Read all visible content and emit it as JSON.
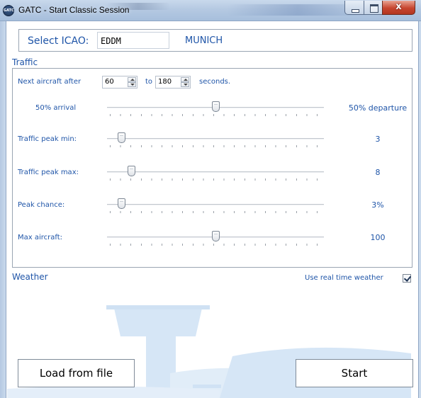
{
  "window": {
    "title": "GATC - Start Classic Session",
    "icon_name": "gatc-logo-icon",
    "icon_text": "GATC",
    "controls": [
      "minimize-icon",
      "maximize-icon",
      "close-icon"
    ],
    "close_glyph": "x"
  },
  "icao": {
    "label": "Select ICAO:",
    "value": "EDDM",
    "city": "MUNICH"
  },
  "traffic": {
    "section_label": "Traffic",
    "next_aircraft": {
      "prefix": "Next aircraft after",
      "min_value": "60",
      "joiner": "to",
      "max_value": "180",
      "suffix": "seconds."
    },
    "sliders": [
      {
        "label": "50% arrival",
        "value_text": "50% departure",
        "level": 0.5
      },
      {
        "label": "Traffic peak min:",
        "value_text": "3",
        "level": 0.04
      },
      {
        "label": "Traffic peak max:",
        "value_text": "8",
        "level": 0.09
      },
      {
        "label": "Peak chance:",
        "value_text": "3%",
        "level": 0.04
      },
      {
        "label": "Max aircraft:",
        "value_text": "100",
        "level": 0.5
      }
    ]
  },
  "weather": {
    "section_label": "Weather",
    "real_time_label": "Use real time weather",
    "real_time_checked": true
  },
  "buttons": {
    "load": "Load from file",
    "start": "Start"
  },
  "colors": {
    "accent": "#1f55a8",
    "background_art": "#d6e6f6"
  }
}
